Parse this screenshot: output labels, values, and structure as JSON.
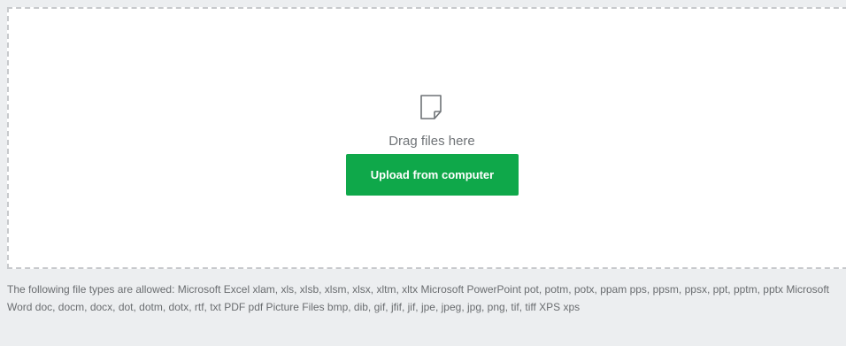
{
  "dropzone": {
    "icon": "file-icon",
    "drag_text": "Drag files here",
    "upload_label": "Upload from computer"
  },
  "allowed_types_text": "The following file types are allowed: Microsoft Excel xlam, xls, xlsb, xlsm, xlsx, xltm, xltx Microsoft PowerPoint pot, potm, potx, ppam pps, ppsm, ppsx, ppt, pptm, pptx Microsoft Word doc, docm, docx, dot, dotm, dotx, rtf, txt PDF pdf Picture Files bmp, dib, gif, jfif, jif, jpe, jpeg, jpg, png, tif, tiff XPS xps",
  "colors": {
    "background": "#eceef0",
    "dropzone_border": "#c7c9cc",
    "button": "#0fa84a",
    "muted_text": "#6f7377"
  }
}
